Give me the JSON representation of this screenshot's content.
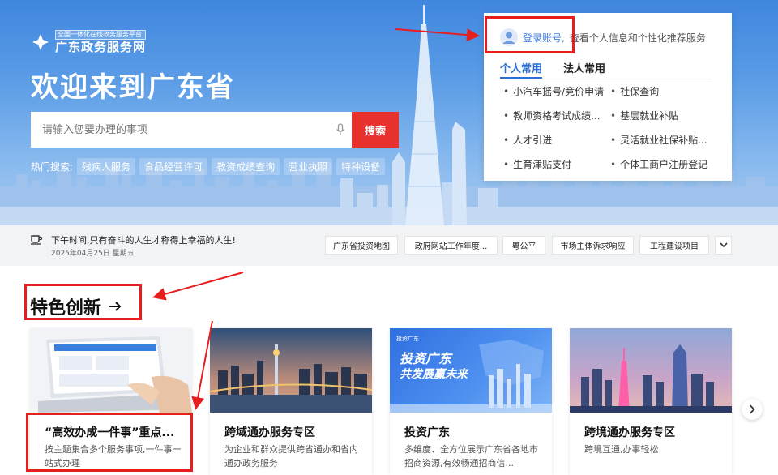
{
  "header": {
    "logo_sub": "全国一体化在线政务服务平台",
    "logo_main": "广东政务服务网",
    "welcome": "欢迎来到广东省"
  },
  "search": {
    "placeholder": "请输入您要办理的事项",
    "button": "搜索",
    "hot_label": "热门搜索:",
    "hot_tags": [
      "残疾人服务",
      "食品经营许可",
      "教资成绩查询",
      "营业执照",
      "特种设备"
    ]
  },
  "login_card": {
    "login_link": "登录账号,",
    "login_desc": "查看个人信息和个性化推荐服务",
    "tabs": [
      "个人常用",
      "法人常用"
    ],
    "services": [
      "小汽车摇号/竞价申请",
      "社保查询",
      "教师资格考试成绩...",
      "基层就业补贴",
      "人才引进",
      "灵活就业社保补贴...",
      "生育津贴支付",
      "个体工商户注册登记"
    ]
  },
  "info_bar": {
    "tip": "下午时间,只有奋斗的人生才称得上幸福的人生!",
    "date": "2025年04月25日 星期五",
    "links": [
      "广东省投资地图",
      "政府网站工作年度...",
      "粤公平",
      "市场主体诉求响应",
      "工程建设项目"
    ]
  },
  "features": {
    "title": "特色创新",
    "cards": [
      {
        "title": "“高效办成一件事”重点...",
        "desc": "按主题集合多个服务事项,一件事一站式办理"
      },
      {
        "title": "跨域通办服务专区",
        "desc": "为企业和群众提供跨省通办和省内通办政务服务"
      },
      {
        "title": "投资广东",
        "desc": "多维度、全方位展示广东省各地市招商资源,有效畅通招商信..."
      },
      {
        "title": "跨境通办服务专区",
        "desc": "跨境互通,办事轻松"
      }
    ],
    "banner_invest": {
      "line1": "投资广东",
      "line2": "共发展赢未来",
      "brand": "投资广东"
    }
  },
  "colors": {
    "primary": "#2b6fd6",
    "search_btn": "#e8302d",
    "annotation": "#e61e1e"
  }
}
